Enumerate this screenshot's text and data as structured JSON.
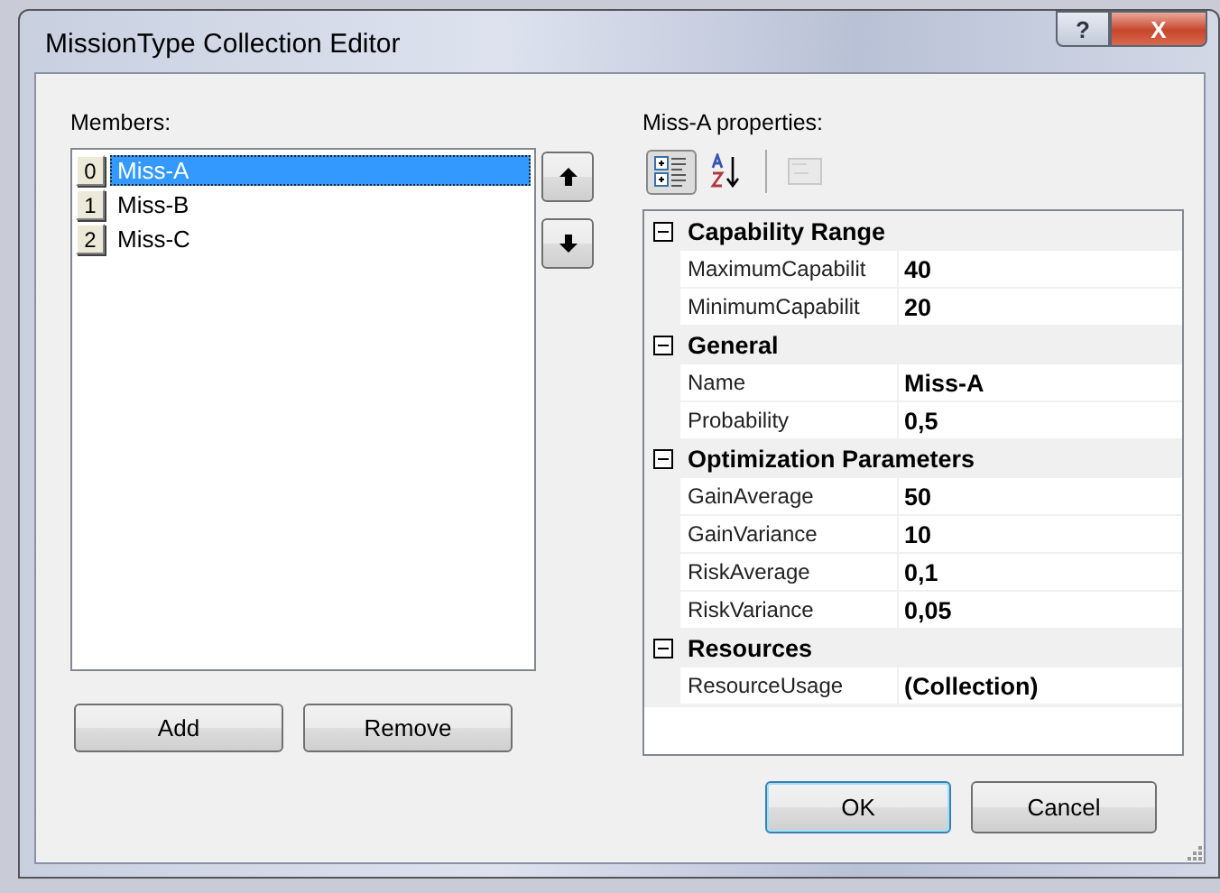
{
  "window": {
    "title": "MissionType Collection Editor",
    "caption_buttons": [
      {
        "kind": "help",
        "label": "?"
      },
      {
        "kind": "close",
        "label": "X"
      }
    ]
  },
  "members": {
    "label": "Members:",
    "items": [
      {
        "index": "0",
        "name": "Miss-A",
        "selected": true
      },
      {
        "index": "1",
        "name": "Miss-B",
        "selected": false
      },
      {
        "index": "2",
        "name": "Miss-C",
        "selected": false
      }
    ],
    "move_buttons": [
      {
        "kind": "up"
      },
      {
        "kind": "down"
      }
    ],
    "buttons": [
      "Add",
      "Remove"
    ]
  },
  "properties": {
    "label": "Miss-A properties:",
    "toolbar": [
      {
        "kind": "categorized",
        "selected": true,
        "disabled": false
      },
      {
        "kind": "alphabetical",
        "selected": false,
        "disabled": false
      },
      {
        "kind": "pages",
        "selected": false,
        "disabled": true
      }
    ],
    "categories": [
      {
        "name": "Capability Range",
        "expanded": true,
        "rows": [
          {
            "name": "MaximumCapabilit",
            "value": "40"
          },
          {
            "name": "MinimumCapabilit",
            "value": "20"
          }
        ]
      },
      {
        "name": "General",
        "expanded": true,
        "rows": [
          {
            "name": "Name",
            "value": "Miss-A"
          },
          {
            "name": "Probability",
            "value": "0,5"
          }
        ]
      },
      {
        "name": "Optimization Parameters",
        "expanded": true,
        "rows": [
          {
            "name": "GainAverage",
            "value": "50"
          },
          {
            "name": "GainVariance",
            "value": "10"
          },
          {
            "name": "RiskAverage",
            "value": "0,1"
          },
          {
            "name": "RiskVariance",
            "value": "0,05"
          }
        ]
      },
      {
        "name": "Resources",
        "expanded": true,
        "rows": [
          {
            "name": "ResourceUsage",
            "value": "(Collection)"
          }
        ]
      }
    ]
  },
  "footer_buttons": [
    {
      "label": "OK",
      "default": true
    },
    {
      "label": "Cancel",
      "default": false
    }
  ]
}
